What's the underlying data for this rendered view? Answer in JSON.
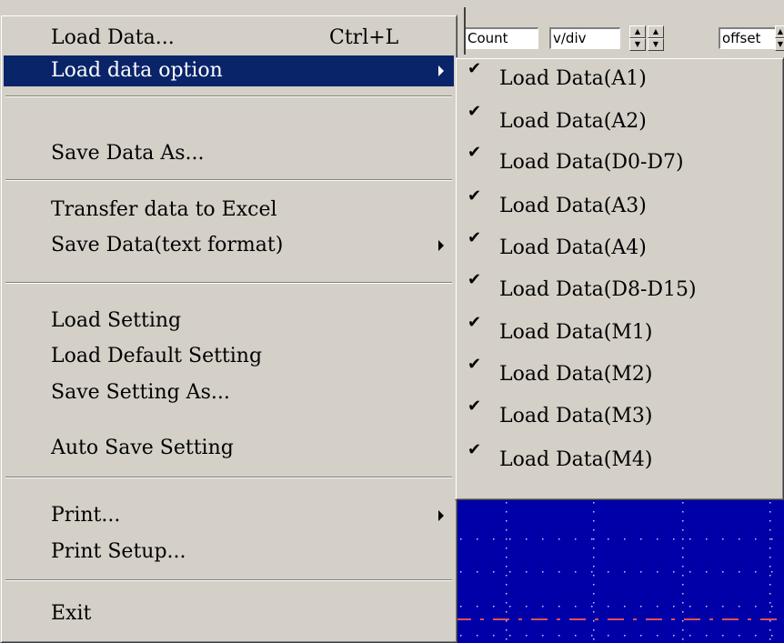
{
  "toolbar": {
    "count_label": "Count",
    "vdiv_label": "v/div",
    "offset_label": "offset",
    "spin_up": "▲",
    "spin_down": "▼"
  },
  "menu": {
    "items": [
      {
        "label": "Load Data...",
        "shortcut": "Ctrl+L"
      },
      {
        "label": "Load data option"
      },
      {
        "label": "Save Data As..."
      },
      {
        "label": "Transfer data to Excel"
      },
      {
        "label": "Save Data(text format)"
      },
      {
        "label": "Load Setting"
      },
      {
        "label": "Load  Default Setting"
      },
      {
        "label": "Save Setting As..."
      },
      {
        "label": "Auto Save Setting"
      },
      {
        "label": "Print..."
      },
      {
        "label": "Print Setup..."
      },
      {
        "label": "Exit"
      }
    ]
  },
  "submenu": {
    "check_glyph": "✔",
    "items": [
      {
        "label": "Load Data(A1)",
        "checked": true
      },
      {
        "label": "Load Data(A2)",
        "checked": true
      },
      {
        "label": "Load Data(D0-D7)",
        "checked": true
      },
      {
        "label": "Load Data(A3)",
        "checked": true
      },
      {
        "label": "Load Data(A4)",
        "checked": true
      },
      {
        "label": "Load Data(D8-D15)",
        "checked": true
      },
      {
        "label": "Load Data(M1)",
        "checked": true
      },
      {
        "label": "Load Data(M2)",
        "checked": true
      },
      {
        "label": "Load Data(M3)",
        "checked": true
      },
      {
        "label": "Load Data(M4)",
        "checked": true
      }
    ]
  },
  "colors": {
    "menu_bg": "#d4d0c8",
    "highlight": "#0a246a",
    "scope_bg": "#0000a8",
    "trace": "#e05050"
  }
}
